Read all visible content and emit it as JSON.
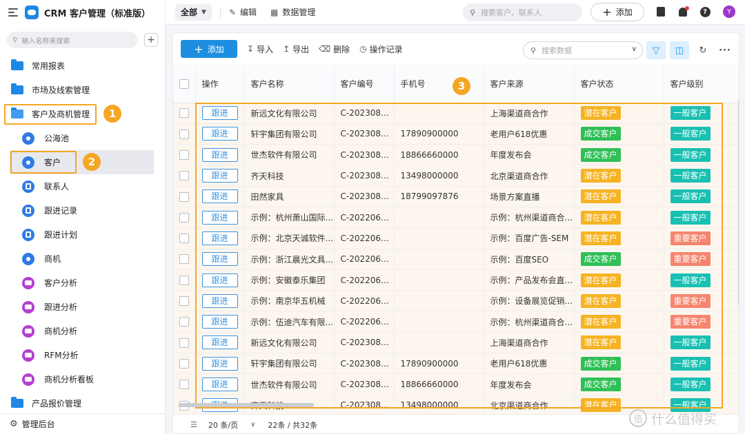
{
  "app": {
    "title": "CRM 客户管理（标准版）"
  },
  "sidebar": {
    "search_placeholder": "输入名称来搜索",
    "add_icon": "+",
    "groups": {
      "reports": "常用报表",
      "marketing": "市场及线索管理",
      "customers": "客户及商机管理",
      "quotes": "产品报价管理"
    },
    "items": [
      {
        "label": "公海池",
        "icon": "user-circle-icon"
      },
      {
        "label": "客户",
        "icon": "user-circle-icon"
      },
      {
        "label": "联系人",
        "icon": "contact-card-icon"
      },
      {
        "label": "跟进记录",
        "icon": "document-icon"
      },
      {
        "label": "跟进计划",
        "icon": "calendar-icon"
      },
      {
        "label": "商机",
        "icon": "target-icon"
      },
      {
        "label": "客户分析",
        "icon": "chart-chat-icon"
      },
      {
        "label": "跟进分析",
        "icon": "chart-chat-icon"
      },
      {
        "label": "商机分析",
        "icon": "chart-chat-icon"
      },
      {
        "label": "RFM分析",
        "icon": "chart-chat-icon"
      },
      {
        "label": "商机分析看板",
        "icon": "chart-chat-icon"
      }
    ],
    "footer_label": "管理后台"
  },
  "topbar": {
    "view": "全部",
    "edit": "编辑",
    "data_manage": "数据管理",
    "search_placeholder": "搜索客户、联系人",
    "add": "添加",
    "avatar": "Y"
  },
  "toolbar": {
    "add": "添加",
    "import": "导入",
    "export": "导出",
    "delete": "删除",
    "log": "操作记录",
    "search_placeholder": "搜索数据",
    "more": "···"
  },
  "annotations": [
    "1",
    "2",
    "3"
  ],
  "table": {
    "headers": [
      "操作",
      "客户名称",
      "客户编号",
      "手机号",
      "客户来源",
      "客户状态",
      "客户级别"
    ],
    "action_label": "跟进",
    "rows": [
      {
        "name": "新远文化有限公司",
        "code": "C-20230809...",
        "phone": "",
        "source": "上海渠道商合作",
        "status": "潜在客户",
        "status_color": "orange",
        "level": "一般客户",
        "level_color": "teal"
      },
      {
        "name": "轩宇集团有限公司",
        "code": "C-20230809...",
        "phone": "17890900000",
        "source": "老用户618优惠",
        "status": "成交客户",
        "status_color": "green",
        "level": "一般客户",
        "level_color": "teal"
      },
      {
        "name": "世杰软件有限公司",
        "code": "C-20230809...",
        "phone": "18866660000",
        "source": "年度发布会",
        "status": "成交客户",
        "status_color": "green",
        "level": "一般客户",
        "level_color": "teal"
      },
      {
        "name": "齐天科技",
        "code": "C-20230809...",
        "phone": "13498000000",
        "source": "北京渠道商合作",
        "status": "潜在客户",
        "status_color": "orange",
        "level": "一般客户",
        "level_color": "teal"
      },
      {
        "name": "田然家具",
        "code": "C-20230809...",
        "phone": "18799097876",
        "source": "场景方案直播",
        "status": "潜在客户",
        "status_color": "orange",
        "level": "一般客户",
        "level_color": "teal"
      },
      {
        "name": "示例：杭州萧山国际...",
        "code": "C-20220614...",
        "phone": "",
        "source": "示例：杭州渠道商合...",
        "status": "潜在客户",
        "status_color": "orange",
        "level": "一般客户",
        "level_color": "teal"
      },
      {
        "name": "示例：北京天诚软件...",
        "code": "C-20220614...",
        "phone": "",
        "source": "示例：百度广告-SEM",
        "status": "潜在客户",
        "status_color": "orange",
        "level": "重要客户",
        "level_color": "salmon"
      },
      {
        "name": "示例：浙江晨光文具...",
        "code": "C-20220614...",
        "phone": "",
        "source": "示例：百度SEO",
        "status": "成交客户",
        "status_color": "green",
        "level": "重要客户",
        "level_color": "salmon"
      },
      {
        "name": "示例：安徽泰乐集团",
        "code": "C-20220614...",
        "phone": "",
        "source": "示例：产品发布会直...",
        "status": "潜在客户",
        "status_color": "orange",
        "level": "一般客户",
        "level_color": "teal"
      },
      {
        "name": "示例：南京华五机械",
        "code": "C-20220614...",
        "phone": "",
        "source": "示例：设备展览促销...",
        "status": "潜在客户",
        "status_color": "orange",
        "level": "重要客户",
        "level_color": "salmon"
      },
      {
        "name": "示例：伍迪汽车有限...",
        "code": "C-20220614...",
        "phone": "",
        "source": "示例：杭州渠道商合...",
        "status": "潜在客户",
        "status_color": "orange",
        "level": "重要客户",
        "level_color": "salmon"
      },
      {
        "name": "新远文化有限公司",
        "code": "C-20230809...",
        "phone": "",
        "source": "上海渠道商合作",
        "status": "潜在客户",
        "status_color": "orange",
        "level": "一般客户",
        "level_color": "teal"
      },
      {
        "name": "轩宇集团有限公司",
        "code": "C-20230809...",
        "phone": "17890900000",
        "source": "老用户618优惠",
        "status": "成交客户",
        "status_color": "green",
        "level": "一般客户",
        "level_color": "teal"
      },
      {
        "name": "世杰软件有限公司",
        "code": "C-20230809...",
        "phone": "18866660000",
        "source": "年度发布会",
        "status": "成交客户",
        "status_color": "green",
        "level": "一般客户",
        "level_color": "teal"
      },
      {
        "name": "齐天科技",
        "code": "C-20230809...",
        "phone": "13498000000",
        "source": "北京渠道商合作",
        "status": "潜在客户",
        "status_color": "orange",
        "level": "一般客户",
        "level_color": "teal"
      }
    ]
  },
  "footer": {
    "page_size": "20 条/页",
    "count": "22条 / 共32条"
  },
  "watermark": {
    "text": "什么值得买",
    "glyph": "值"
  },
  "colors": {
    "accent": "#1e8fe0",
    "highlight": "#f5a623",
    "tag_orange": "#f5b324",
    "tag_green": "#2fbf57",
    "tag_teal": "#19c0b2",
    "tag_salmon": "#f5856e"
  }
}
